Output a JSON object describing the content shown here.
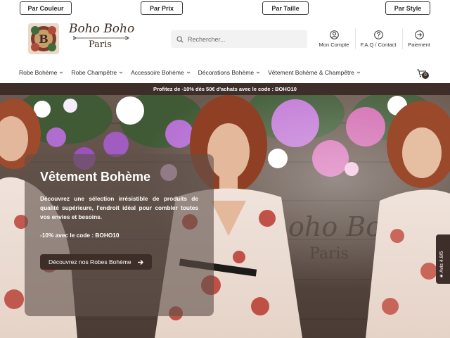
{
  "filters": [
    "Par Couleur",
    "Par Prix",
    "Par Taille",
    "Par Style"
  ],
  "logo": {
    "line1": "Boho Boho",
    "line2": "Paris"
  },
  "search": {
    "placeholder": "Rechercher..."
  },
  "header_links": {
    "account": "Mon Compte",
    "faq": "F.A.Q / Contact",
    "payment": "Paiement"
  },
  "nav": {
    "items": [
      "Robe Bohème",
      "Robe Champêtre",
      "Accessoire Bohème",
      "Décorations Bohème",
      "Vêtement Bohème & Champêtre"
    ],
    "cart_count": "0"
  },
  "promo": {
    "text": "Profitez de -10% dès 50€ d'achats avec le code : BOHO10"
  },
  "hero": {
    "title": "Vêtement Bohème",
    "description": "Découvrez une sélection irrésistible de produits de qualité supérieure, l'endroit idéal pour combler toutes vos envies et besoins.",
    "code": "-10% avec le code : BOHO10",
    "button": "Découvrez nos Robes Bohème"
  },
  "reviews_tab": "★ Avis 4.8/5",
  "colors": {
    "brand_dark": "#3d2e29",
    "promo_bg": "#3d2e29",
    "text": "#2b2b2b"
  },
  "icons": [
    "emblem-logo",
    "search-icon",
    "user-icon",
    "help-icon",
    "arrow-circle-icon",
    "cart-icon",
    "arrow-right-icon",
    "star-icon"
  ]
}
